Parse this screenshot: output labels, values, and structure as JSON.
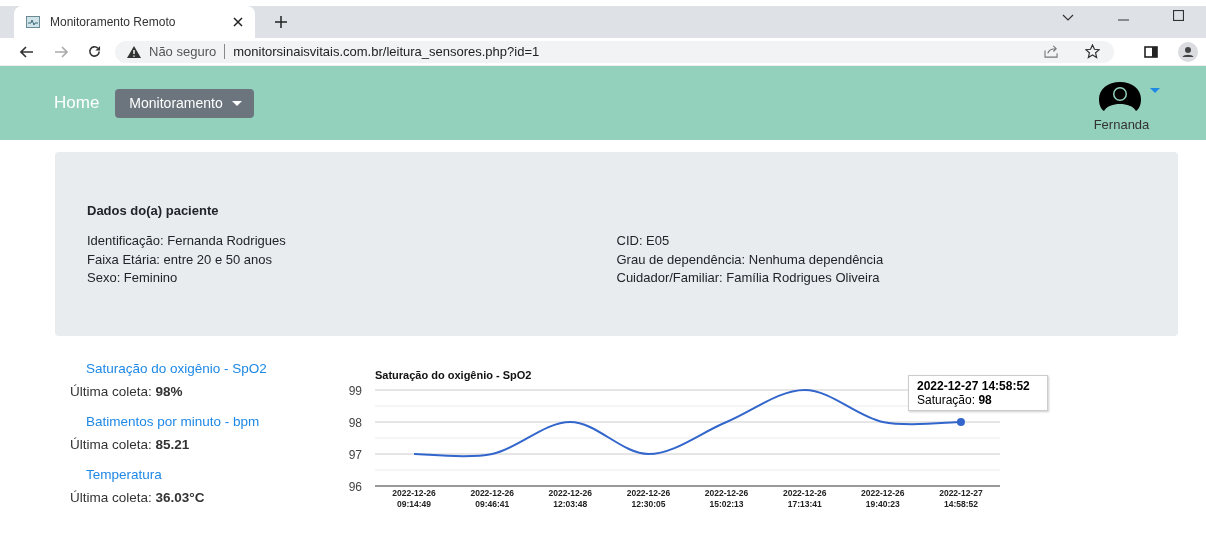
{
  "browser": {
    "tab_title": "Monitoramento Remoto",
    "security": "Não seguro",
    "url": "monitorsinaisvitais.com.br/leitura_sensores.php?id=1"
  },
  "navbar": {
    "home": "Home",
    "menu": "Monitoramento",
    "user": "Fernanda"
  },
  "patient": {
    "heading": "Dados do(a) paciente",
    "left": [
      "Identificação: Fernanda Rodrigues",
      "Faixa Etária: entre 20 e 50 anos",
      "Sexo: Feminino"
    ],
    "right": [
      "CID: E05",
      "Grau de dependência: Nenhuma dependência",
      "Cuidador/Familiar: Família Rodrigues Oliveira"
    ]
  },
  "vitals": [
    {
      "title": "Saturação do oxigênio - SpO2",
      "reading": "Última coleta: **98%**"
    },
    {
      "title": "Batimentos por minuto - bpm",
      "reading": "Última coleta: **85.21**"
    },
    {
      "title": "Temperatura",
      "reading": "Última coleta: **36.03°C**"
    }
  ],
  "chart": {
    "chart_data": {
      "type": "line",
      "title": "Saturação do oxigênio - SpO2",
      "categories": [
        "2022-12-26 09:14:49",
        "2022-12-26 09:46:41",
        "2022-12-26 12:03:48",
        "2022-12-26 12:30:05",
        "2022-12-26 15:02:13",
        "2022-12-26 17:13:41",
        "2022-12-26 19:40:23",
        "2022-12-27 14:58:52"
      ],
      "series": [
        {
          "color": "#3366cc",
          "values": [
            97,
            97,
            98,
            97,
            98,
            99,
            98,
            98
          ]
        }
      ],
      "ylim": [
        96,
        99
      ],
      "yticks": [
        96,
        97,
        98,
        99
      ]
    },
    "tooltip": {
      "title": "2022-12-27 14:58:52",
      "text": "Saturação: **98**"
    }
  }
}
